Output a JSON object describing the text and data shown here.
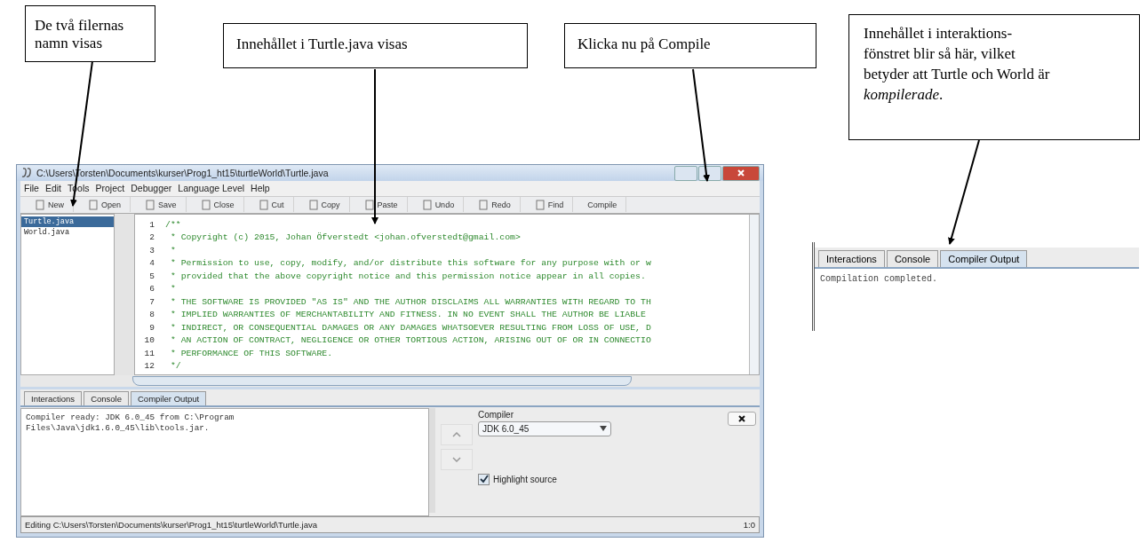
{
  "callouts": [
    {
      "text": "De två filernas namn  visas"
    },
    {
      "text": "Innehållet i Turtle.java visas"
    },
    {
      "text": "Klicka nu på Compile"
    },
    {
      "text": "Innehållet i interaktions-fönstret  blir så här, vilket betyder att Turtle och World är *kompilerade*."
    }
  ],
  "window": {
    "title": "C:\\Users\\Torsten\\Documents\\kurser\\Prog1_ht15\\turtleWorld\\Turtle.java",
    "menu": [
      "File",
      "Edit",
      "Tools",
      "Project",
      "Debugger",
      "Language Level",
      "Help"
    ],
    "toolbar": [
      "New",
      "Open",
      "Save",
      "Close",
      "Cut",
      "Copy",
      "Paste",
      "Undo",
      "Redo",
      "Find",
      "Compile"
    ],
    "files": [
      {
        "name": "Turtle.java",
        "selected": true
      },
      {
        "name": "World.java",
        "selected": false
      }
    ],
    "code": [
      {
        "n": "1",
        "text": "/**"
      },
      {
        "n": "2",
        "text": " * Copyright (c) 2015, Johan Öfverstedt <johan.ofverstedt@gmail.com>"
      },
      {
        "n": "3",
        "text": " *"
      },
      {
        "n": "4",
        "text": " * Permission to use, copy, modify, and/or distribute this software for any purpose with or w"
      },
      {
        "n": "5",
        "text": " * provided that the above copyright notice and this permission notice appear in all copies."
      },
      {
        "n": "6",
        "text": " *"
      },
      {
        "n": "7",
        "text": " * THE SOFTWARE IS PROVIDED \"AS IS\" AND THE AUTHOR DISCLAIMS ALL WARRANTIES WITH REGARD TO TH"
      },
      {
        "n": "8",
        "text": " * IMPLIED WARRANTIES OF MERCHANTABILITY AND FITNESS. IN NO EVENT SHALL THE AUTHOR BE LIABLE"
      },
      {
        "n": "9",
        "text": " * INDIRECT, OR CONSEQUENTIAL DAMAGES OR ANY DAMAGES WHATSOEVER RESULTING FROM LOSS OF USE, D"
      },
      {
        "n": "10",
        "text": " * AN ACTION OF CONTRACT, NEGLIGENCE OR OTHER TORTIOUS ACTION, ARISING OUT OF OR IN CONNECTIO"
      },
      {
        "n": "11",
        "text": " * PERFORMANCE OF THIS SOFTWARE."
      },
      {
        "n": "12",
        "text": " */"
      }
    ],
    "tabs": [
      {
        "label": "Interactions",
        "selected": false
      },
      {
        "label": "Console",
        "selected": false
      },
      {
        "label": "Compiler Output",
        "selected": true
      }
    ],
    "output": "Compiler ready: JDK 6.0_45 from C:\\Program Files\\Java\\jdk1.6.0_45\\lib\\tools.jar.",
    "compiler": {
      "label": "Compiler",
      "value": "JDK 6.0_45",
      "highlight": {
        "label": "Highlight source",
        "checked": true
      }
    },
    "status_bar": {
      "text": "Editing C:\\Users\\Torsten\\Documents\\kurser\\Prog1_ht15\\turtleWorld\\Turtle.java",
      "position": "1:0"
    }
  },
  "inset": {
    "tabs": [
      {
        "label": "Interactions",
        "selected": false
      },
      {
        "label": "Console",
        "selected": false
      },
      {
        "label": "Compiler Output",
        "selected": true
      }
    ],
    "output": "Compilation completed."
  }
}
